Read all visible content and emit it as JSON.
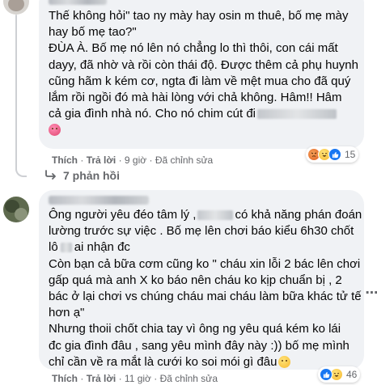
{
  "comments": [
    {
      "lines": [
        "Thế không hỏi\" tao ny mày hay osin m thuê, bố mẹ mày",
        "hay bố mẹ tao?\"",
        "ĐÙA À. Bố mẹ nó lên nó chẳng lo thì thôi, con cái mất",
        "dayy, đã nhờ và rồi còn thái độ. Được thêm cả phụ huynh",
        "cũng hãm k kém cơ, ngta đi làm về mệt mua cho đã quý",
        "lắm rồi ngồi đó mà hài lòng với chả không. Hâm!! Hâm",
        "cả gia đình nhà nó. Cho nó chim cút đi"
      ],
      "actions": {
        "like": "Thích",
        "reply": "Trả lời",
        "time": "9 giờ",
        "edited": "Đã chỉnh sửa"
      },
      "reaction_count": "15",
      "replies_label": "7 phản hồi"
    },
    {
      "lines": [
        "Ông người yêu đéo tâm lý ,",
        "có khả năng phán đoán",
        "lường trước sự việc . Bố mẹ lên chơi báo kiểu 6h30 chốt",
        "lô",
        "ai nhận đc",
        "Còn bạn cả bữa cơm cũng ko \" cháu xin lỗi 2 bác lên chơi",
        "gấp quá mà anh X ko báo nên cháu ko kịp chuẩn bị , 2",
        "bác ở lại chơi vs chúng cháu mai cháu làm bữa khác tử tế",
        "hơn ạ\"",
        "Nhưng thoii chốt chia tay vì ông ng yêu quá kém ko lái",
        "đc gia đình đâu , sang yêu mình đây này :)) bố mẹ mình",
        "chỉ cần về ra mắt là cưới ko soi mói gì đâu"
      ],
      "actions": {
        "like": "Thích",
        "reply": "Trả lời",
        "time": "11 giờ",
        "edited": "Đã chỉnh sửa"
      },
      "reaction_count": "46"
    }
  ],
  "icons": {
    "like": "thumbs-up",
    "haha": "laughing-face",
    "angry": "angry-face",
    "more": "more-options"
  },
  "colors": {
    "bubble": "#f0f2f5",
    "text": "#050505",
    "meta": "#65676b",
    "like_blue": "#1877f2"
  }
}
